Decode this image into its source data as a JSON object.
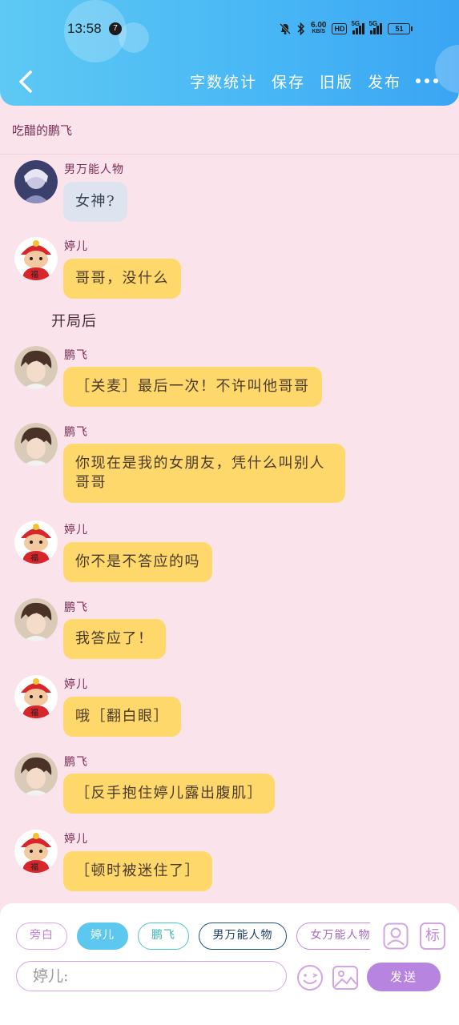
{
  "status_bar": {
    "time": "13:58",
    "notif_count": "7",
    "net_speed_top": "6.00",
    "net_speed_unit": "KB/S",
    "hd": "HD",
    "sig1": "5G",
    "sig2": "5G",
    "battery": "51"
  },
  "toolbar": {
    "word_count": "字数统计",
    "save": "保存",
    "old_version": "旧版",
    "publish": "发布"
  },
  "chat_title": "吃醋的鹏飞",
  "messages": [
    {
      "sender": "男万能人物",
      "text": "女神?"
    },
    {
      "sender": "婷儿",
      "text": "哥哥，没什么"
    },
    {
      "narration": "开局后"
    },
    {
      "sender": "鹏飞",
      "text": "［关麦］最后一次！不许叫他哥哥"
    },
    {
      "sender": "鹏飞",
      "text": "你现在是我的女朋友，凭什么叫别人哥哥"
    },
    {
      "sender": "婷儿",
      "text": "你不是不答应的吗"
    },
    {
      "sender": "鹏飞",
      "text": "我答应了！"
    },
    {
      "sender": "婷儿",
      "text": "哦［翻白眼］"
    },
    {
      "sender": "鹏飞",
      "text": "［反手抱住婷儿露出腹肌］"
    },
    {
      "sender": "婷儿",
      "text": "［顿时被迷住了］"
    }
  ],
  "roles": [
    "旁白",
    "婷儿",
    "鹏飞",
    "男万能人物",
    "女万能人物"
  ],
  "role_mark_label": "标",
  "input": {
    "placeholder": "婷儿:"
  },
  "send_label": "发送",
  "colors": {
    "header": "#47b6f5",
    "bubble": "#ffd86b",
    "background": "#fbe3ec",
    "send": "#b784e0"
  }
}
